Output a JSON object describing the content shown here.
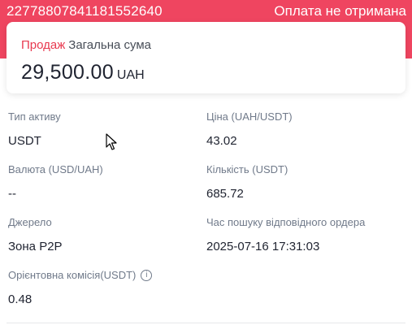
{
  "header": {
    "order_id": "22778807841181552640",
    "status": "Оплата не отримана",
    "accent_color": "#ef4560"
  },
  "summary": {
    "trade_type": "Продаж",
    "label": "Загальна сума",
    "amount": "29,500.00",
    "currency": "UAH",
    "trade_type_color": "#e8394f"
  },
  "details": {
    "asset_type": {
      "label": "Тип активу",
      "value": "USDT"
    },
    "price": {
      "label": "Ціна (UAH/USDT)",
      "value": "43.02"
    },
    "currency": {
      "label": "Валюта (USD/UAH)",
      "value": "--"
    },
    "quantity": {
      "label": "Кількість (USDT)",
      "value": "685.72"
    },
    "source": {
      "label": "Джерело",
      "value": "Зона P2P"
    },
    "search_time": {
      "label": "Час пошуку відповідного ордера",
      "value": "2025-07-16 17:31:03"
    },
    "fee": {
      "label": "Орієнтовна комісія(USDT)",
      "value": "0.48",
      "icon": "info-icon",
      "icon_glyph": "i"
    }
  }
}
